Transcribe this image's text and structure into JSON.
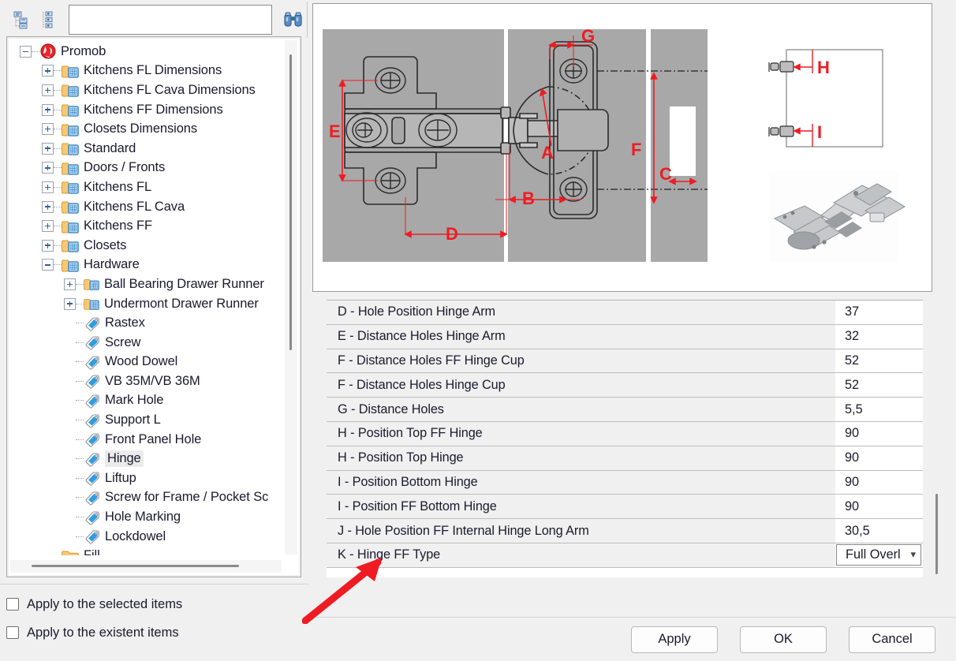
{
  "toolbar": {
    "expand_all_icon": "expand-tree-icon",
    "collapse_all_icon": "list-tree-icon",
    "search_value": "",
    "search_placeholder": "",
    "find_icon": "binoculars-icon"
  },
  "tree": {
    "root_label": "Promob",
    "root_icon": "promob-globe-icon",
    "items": [
      {
        "label": "Kitchens FL Dimensions",
        "depth": 1,
        "state": "plus",
        "icon": "folder-table-icon",
        "selected": false
      },
      {
        "label": "Kitchens FL Cava Dimensions",
        "depth": 1,
        "state": "plus",
        "icon": "folder-table-icon",
        "selected": false
      },
      {
        "label": "Kitchens FF Dimensions",
        "depth": 1,
        "state": "plus",
        "icon": "folder-table-icon",
        "selected": false
      },
      {
        "label": "Closets Dimensions",
        "depth": 1,
        "state": "plus",
        "icon": "folder-table-icon",
        "selected": false
      },
      {
        "label": "Standard",
        "depth": 1,
        "state": "plus",
        "icon": "folder-table-icon",
        "selected": false
      },
      {
        "label": "Doors / Fronts",
        "depth": 1,
        "state": "plus",
        "icon": "folder-table-icon",
        "selected": false
      },
      {
        "label": "Kitchens FL",
        "depth": 1,
        "state": "plus",
        "icon": "folder-table-icon",
        "selected": false
      },
      {
        "label": "Kitchens FL Cava",
        "depth": 1,
        "state": "plus",
        "icon": "folder-table-icon",
        "selected": false
      },
      {
        "label": "Kitchens FF",
        "depth": 1,
        "state": "plus",
        "icon": "folder-table-icon",
        "selected": false
      },
      {
        "label": "Closets",
        "depth": 1,
        "state": "plus",
        "icon": "folder-table-icon",
        "selected": false
      },
      {
        "label": "Hardware",
        "depth": 1,
        "state": "minus",
        "icon": "folder-table-icon",
        "selected": false
      },
      {
        "label": "Ball Bearing Drawer Runner",
        "depth": 2,
        "state": "plus",
        "icon": "folder-table-icon",
        "selected": false
      },
      {
        "label": "Undermont Drawer Runner",
        "depth": 2,
        "state": "plus",
        "icon": "folder-table-icon",
        "selected": false
      },
      {
        "label": "Rastex",
        "depth": 2,
        "state": "leaf",
        "icon": "tag-icon",
        "selected": false
      },
      {
        "label": "Screw",
        "depth": 2,
        "state": "leaf",
        "icon": "tag-icon",
        "selected": false
      },
      {
        "label": "Wood Dowel",
        "depth": 2,
        "state": "leaf",
        "icon": "tag-icon",
        "selected": false
      },
      {
        "label": "VB 35M/VB 36M",
        "depth": 2,
        "state": "leaf",
        "icon": "tag-icon",
        "selected": false
      },
      {
        "label": "Mark Hole",
        "depth": 2,
        "state": "leaf",
        "icon": "tag-icon",
        "selected": false
      },
      {
        "label": "Support L",
        "depth": 2,
        "state": "leaf",
        "icon": "tag-icon",
        "selected": false
      },
      {
        "label": "Front Panel Hole",
        "depth": 2,
        "state": "leaf",
        "icon": "tag-icon",
        "selected": false
      },
      {
        "label": "Hinge",
        "depth": 2,
        "state": "leaf",
        "icon": "tag-icon",
        "selected": true
      },
      {
        "label": "Liftup",
        "depth": 2,
        "state": "leaf",
        "icon": "tag-icon",
        "selected": false
      },
      {
        "label": "Screw for Frame / Pocket Sc",
        "depth": 2,
        "state": "leaf",
        "icon": "tag-icon",
        "selected": false
      },
      {
        "label": "Hole Marking",
        "depth": 2,
        "state": "leaf",
        "icon": "tag-icon",
        "selected": false
      },
      {
        "label": "Lockdowel",
        "depth": 2,
        "state": "leaf",
        "icon": "tag-icon",
        "selected": false
      },
      {
        "label": "Fill",
        "depth": 1,
        "state": "leaf",
        "icon": "folder-icon",
        "selected": false
      }
    ]
  },
  "preview": {
    "dimension_labels": [
      "A",
      "B",
      "C",
      "D",
      "E",
      "F",
      "G",
      "H",
      "I"
    ],
    "accent_color": "#ee1c22",
    "panel_bg": "#a8a8a8"
  },
  "properties": {
    "rows": [
      {
        "label": "D - Hole Position Hinge Arm",
        "value": "37",
        "type": "text"
      },
      {
        "label": "E - Distance Holes Hinge Arm",
        "value": "32",
        "type": "text"
      },
      {
        "label": "F - Distance Holes FF Hinge Cup",
        "value": "52",
        "type": "text"
      },
      {
        "label": "F - Distance Holes Hinge Cup",
        "value": "52",
        "type": "text"
      },
      {
        "label": "G - Distance Holes",
        "value": "5,5",
        "type": "text"
      },
      {
        "label": "H - Position Top FF Hinge",
        "value": "90",
        "type": "text"
      },
      {
        "label": "H - Position Top Hinge",
        "value": "90",
        "type": "text"
      },
      {
        "label": "I - Position Bottom Hinge",
        "value": "90",
        "type": "text"
      },
      {
        "label": "I - Position FF Bottom Hinge",
        "value": "90",
        "type": "text"
      },
      {
        "label": "J - Hole Position FF Internal Hinge Long Arm",
        "value": "30,5",
        "type": "text"
      },
      {
        "label": "K - Hinge FF Type",
        "value": "Full Overl",
        "type": "combo",
        "chevron": "chevron-down-icon"
      }
    ]
  },
  "options": {
    "apply_selected_label": "Apply to the selected items",
    "apply_selected_checked": false,
    "apply_existent_label": "Apply to the existent items",
    "apply_existent_checked": false
  },
  "buttons": {
    "apply": "Apply",
    "ok": "OK",
    "cancel": "Cancel"
  },
  "annotation": {
    "arrow_color": "#ee1c22",
    "points_to": "K - Hinge FF Type"
  }
}
